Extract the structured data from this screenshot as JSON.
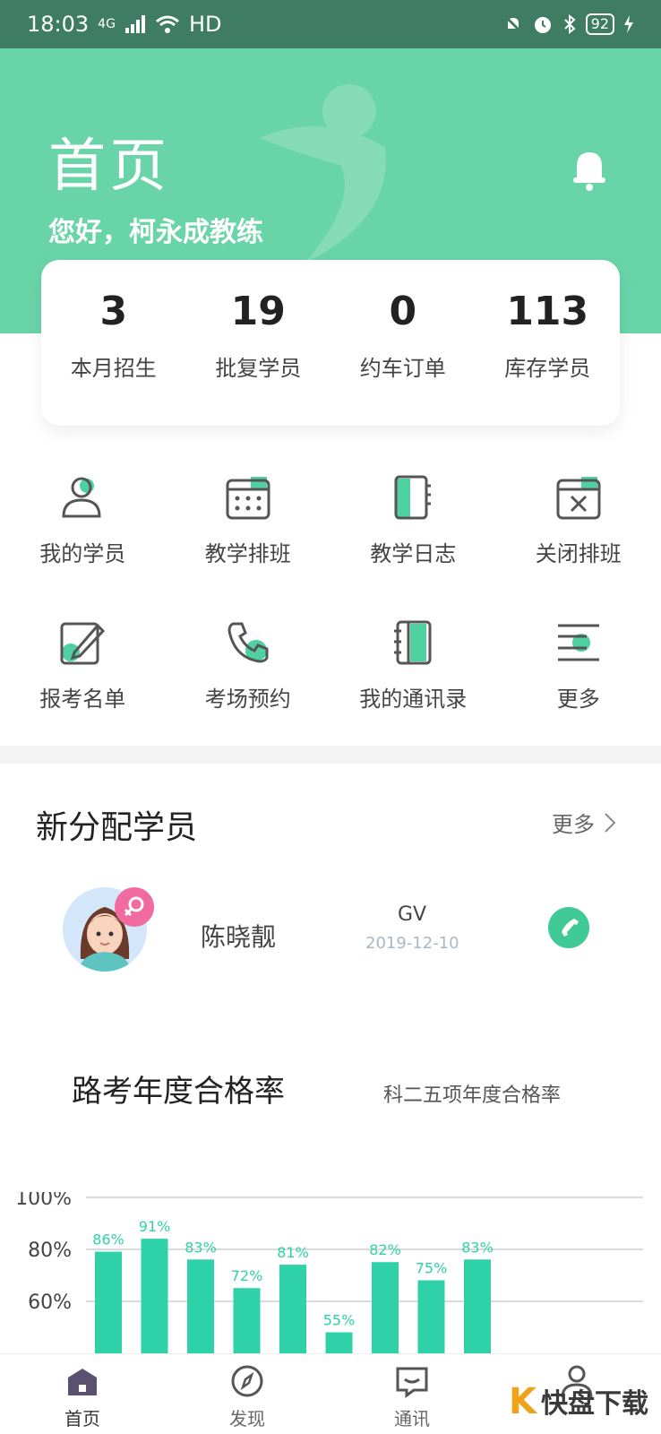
{
  "status_bar": {
    "time": "18:03",
    "network": "4G",
    "wifi": "HD",
    "battery": "92"
  },
  "header": {
    "title": "首页",
    "greeting": "您好，柯永成教练"
  },
  "stats": [
    {
      "value": "3",
      "label": "本月招生"
    },
    {
      "value": "19",
      "label": "批复学员"
    },
    {
      "value": "0",
      "label": "约车订单"
    },
    {
      "value": "113",
      "label": "库存学员"
    }
  ],
  "grid": [
    {
      "label": "我的学员",
      "icon": "user-icon"
    },
    {
      "label": "教学排班",
      "icon": "calendar-icon"
    },
    {
      "label": "教学日志",
      "icon": "notebook-icon"
    },
    {
      "label": "关闭排班",
      "icon": "calendar-close-icon"
    },
    {
      "label": "报考名单",
      "icon": "edit-icon"
    },
    {
      "label": "考场预约",
      "icon": "phone-icon"
    },
    {
      "label": "我的通讯录",
      "icon": "contacts-icon"
    },
    {
      "label": "更多",
      "icon": "menu-icon"
    }
  ],
  "new_students": {
    "title": "新分配学员",
    "more": "更多",
    "items": [
      {
        "name": "陈晓靓",
        "class": "GV",
        "date": "2019-12-10",
        "gender": "female"
      }
    ]
  },
  "pass_rate": {
    "title": "路考年度合格率",
    "subtitle": "科二五项年度合格率"
  },
  "chart_data": {
    "type": "bar",
    "y_ticks": [
      "100%",
      "80%",
      "60%"
    ],
    "ylim": [
      0,
      100
    ],
    "values": [
      86,
      91,
      83,
      72,
      81,
      55,
      82,
      75,
      83
    ],
    "value_labels": [
      "86%",
      "91%",
      "83%",
      "72%",
      "81%",
      "55%",
      "82%",
      "75%",
      "83%"
    ],
    "color": "#2fd2a8"
  },
  "bottom_nav": [
    {
      "label": "首页",
      "icon": "home-icon",
      "active": true
    },
    {
      "label": "发现",
      "icon": "compass-icon",
      "active": false
    },
    {
      "label": "通讯",
      "icon": "message-icon",
      "active": false
    },
    {
      "label": "",
      "icon": "profile-icon",
      "active": false
    }
  ],
  "watermark": {
    "brand": "快盘下载"
  },
  "colors": {
    "accent": "#6ad4a9",
    "status_bar": "#3e7d63",
    "chart_bar": "#2fd2a8"
  }
}
